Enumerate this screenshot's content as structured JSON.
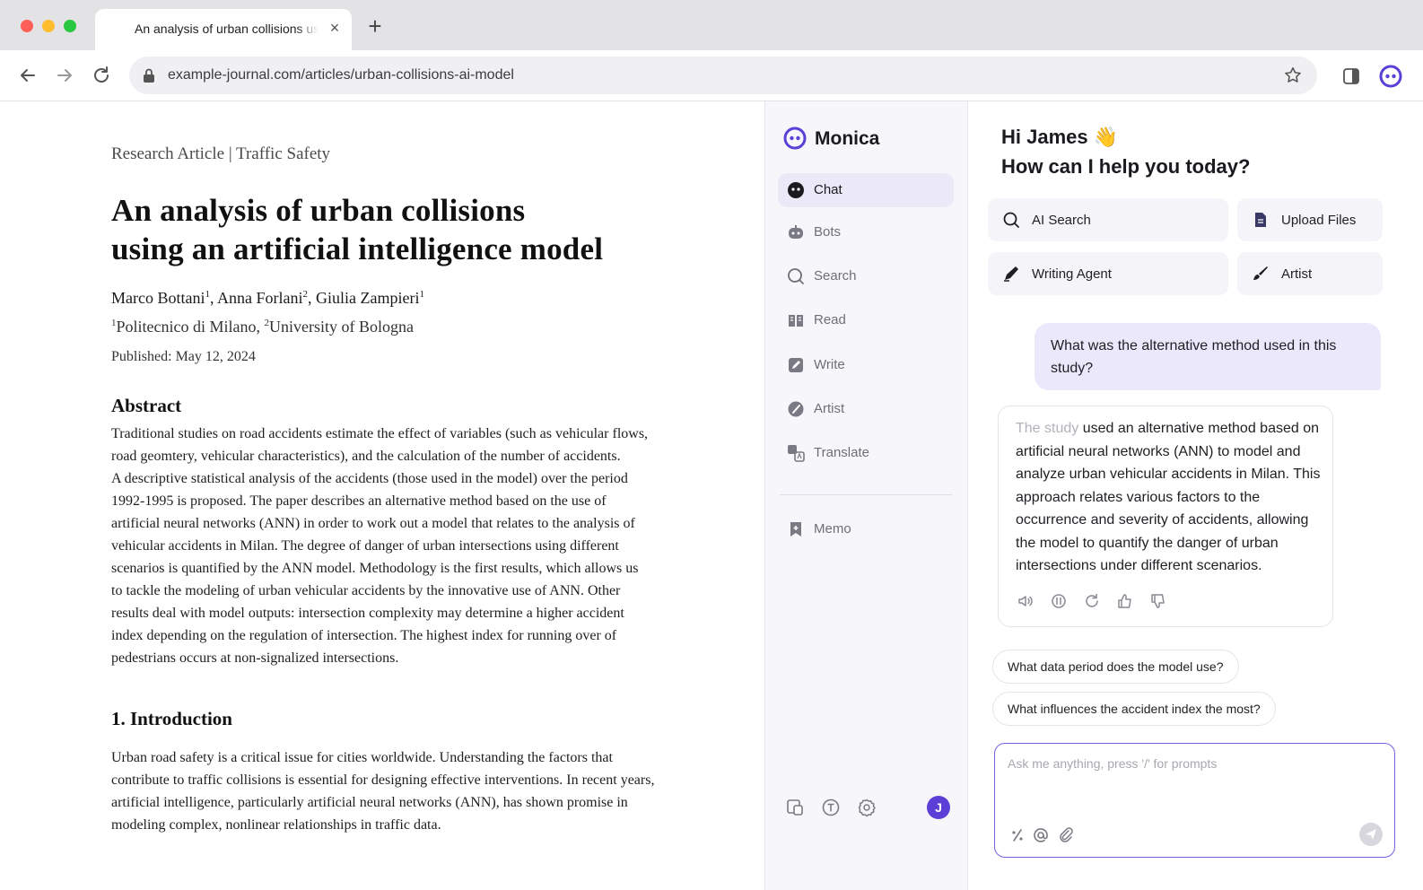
{
  "browser": {
    "tab_title": "An analysis of urban collisions using an artificial intelligence model",
    "tab_close": "×",
    "new_tab": "+",
    "url": "example-journal.com/articles/urban-collisions-ai-model"
  },
  "article": {
    "kicker": "Research Article | Traffic Safety",
    "title_line1": "An analysis of urban collisions",
    "title_line2": "using an artificial intelligence model",
    "authors": [
      {
        "name": "Marco Bottani",
        "sup": "1",
        "sep": ", "
      },
      {
        "name": "Anna Forlani",
        "sup": "2",
        "sep": ", "
      },
      {
        "name": "Giulia Zampieri",
        "sup": "1",
        "sep": ""
      }
    ],
    "affiliations": [
      {
        "sup": "1",
        "name": "Politecnico di Milano",
        "sep": ", "
      },
      {
        "sup": "2",
        "name": "University of Bologna",
        "sep": ""
      }
    ],
    "published": "Published: May 12, 2024",
    "abstract_heading": "Abstract",
    "abstract_lines": [
      "Traditional studies on road accidents estimate the effect of variables (such as vehicular flows,",
      "road geomtery, vehicular characteristics), and the calculation of the number of accidents.",
      "A descriptive statistical analysis of the accidents (those used in the model) over the period",
      "1992-1995 is proposed. The paper describes an alternative method based on the use of",
      "artificial neural networks (ANN) in order to work out a model that relates to the analysis of",
      "vehicular accidents in Milan. The degree of danger of urban intersections using different",
      "scenarios is quantified by the ANN model. Methodology is the first results, which allows us",
      "to tackle the modeling of urban vehicular accidents by the innovative use of ANN. Other",
      "results deal with model outputs: intersection complexity may determine a higher accident",
      "index depending on the regulation of intersection. The highest index for running over of",
      "pedestrians occurs at non-signalized intersections."
    ],
    "intro_heading": "1. Introduction",
    "intro_lines": [
      "Urban road safety is a critical issue for cities worldwide. Understanding the factors that",
      "contribute to traffic collisions is essential for designing effective interventions. In recent years,",
      "artificial intelligence, particularly artificial neural networks (ANN), has shown promise in",
      "modeling complex, nonlinear relationships in traffic data."
    ]
  },
  "monica": {
    "brand": "Monica",
    "nav": [
      {
        "label": "Chat",
        "icon": "chat-icon",
        "active": true
      },
      {
        "label": "Bots",
        "icon": "bot-icon",
        "active": false
      },
      {
        "label": "Search",
        "icon": "search-icon",
        "active": false
      },
      {
        "label": "Read",
        "icon": "read-icon",
        "active": false
      },
      {
        "label": "Write",
        "icon": "write-icon",
        "active": false
      },
      {
        "label": "Artist",
        "icon": "artist-icon",
        "active": false
      },
      {
        "label": "Translate",
        "icon": "translate-icon",
        "active": false
      },
      {
        "label": "Memo",
        "icon": "memo-icon",
        "active": false
      }
    ],
    "user_initial": "J",
    "accent": "#5b3fd6",
    "greeting_line1": "Hi James",
    "greeting_emoji": "👋",
    "greeting_line2": "How can I help you today?",
    "quick_actions": [
      {
        "label": "AI Search",
        "icon": "search-icon"
      },
      {
        "label": "Upload Files",
        "icon": "file-icon"
      },
      {
        "label": "Writing Agent",
        "icon": "pen-icon"
      },
      {
        "label": "Artist",
        "icon": "brush-icon"
      }
    ],
    "user_message": "What was the alternative method used in this study?",
    "ai_reply_faded": "The study",
    "ai_reply": " used an alternative method based on artificial neural networks (ANN) to model and analyze urban vehicular accidents in Milan. This approach relates various factors to the occurrence and severity of accidents, allowing the model to quantify the danger of urban intersections under different scenarios.",
    "suggestions": [
      "What data period does the model use?",
      "What influences the accident index the most?"
    ],
    "composer_placeholder": "Ask me anything, press '/' for prompts"
  }
}
